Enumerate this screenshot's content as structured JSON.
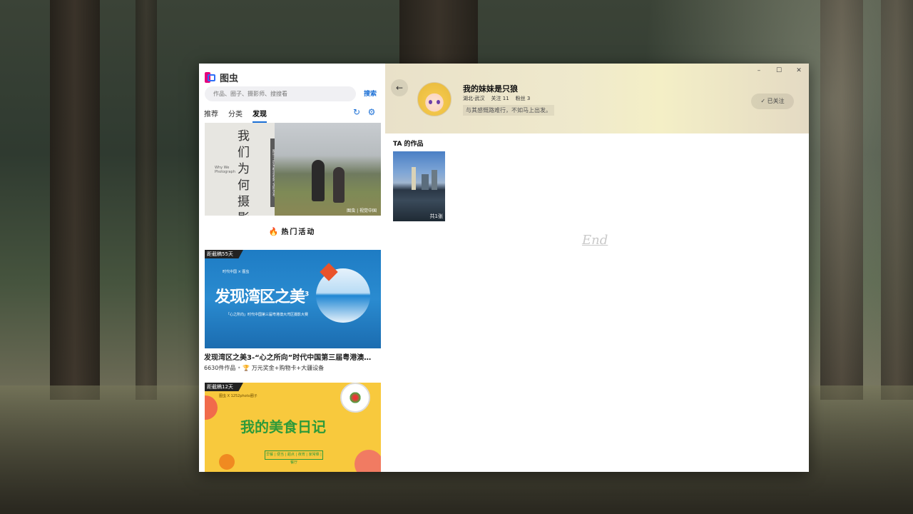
{
  "app": {
    "name": "图虫",
    "search": {
      "placeholder": "作品、圈子、摄影师、搜搜看",
      "button": "搜索"
    },
    "tabs": [
      {
        "label": "推荐",
        "active": false
      },
      {
        "label": "分类",
        "active": false
      },
      {
        "label": "发现",
        "active": true
      }
    ]
  },
  "discover": {
    "banner1": {
      "chars": "我们为何摄影",
      "en_text": "Why We Photograph",
      "strip_text": "图虫十周年概念视频·全网发布",
      "watermark": "图虫 | 视觉中国"
    },
    "hot_title": "热门活动",
    "activities": [
      {
        "tag": "距截稿55天",
        "sponsors": "时代中国 × 图虫",
        "poster_title": "发现湾区之美",
        "poster_superscript": "3",
        "poster_caption": "「心之所向」时代中国第三届粤港澳大湾区摄影大赛",
        "title": "发现湾区之美3-“心之所向”时代中国第三届粤港澳…",
        "works": "6630件作品",
        "separator": "•",
        "prize": "万元奖金+购物卡+大疆设备"
      },
      {
        "tag": "距截稿12天",
        "sponsors": "图虫 X 1252photo圈子",
        "poster_title": "我的美食日记",
        "poster_box": "早餐 | 便当 | 甜点 | 夜宵 | 家常菜 | 餐厅"
      }
    ]
  },
  "window_controls": {
    "minimize": "–",
    "maximize": "☐",
    "close": "✕"
  },
  "profile": {
    "back": "←",
    "name": "我的妹妹是只狼",
    "location": "湖北-武汉",
    "following": "关注 11",
    "followers": "粉丝 3",
    "bio": "与其感慨路难行，不如马上出发。",
    "follow_button": "已关注",
    "section_title": "TA 的作品",
    "works": [
      {
        "count_label": "共1张"
      }
    ],
    "end_text": "End"
  }
}
